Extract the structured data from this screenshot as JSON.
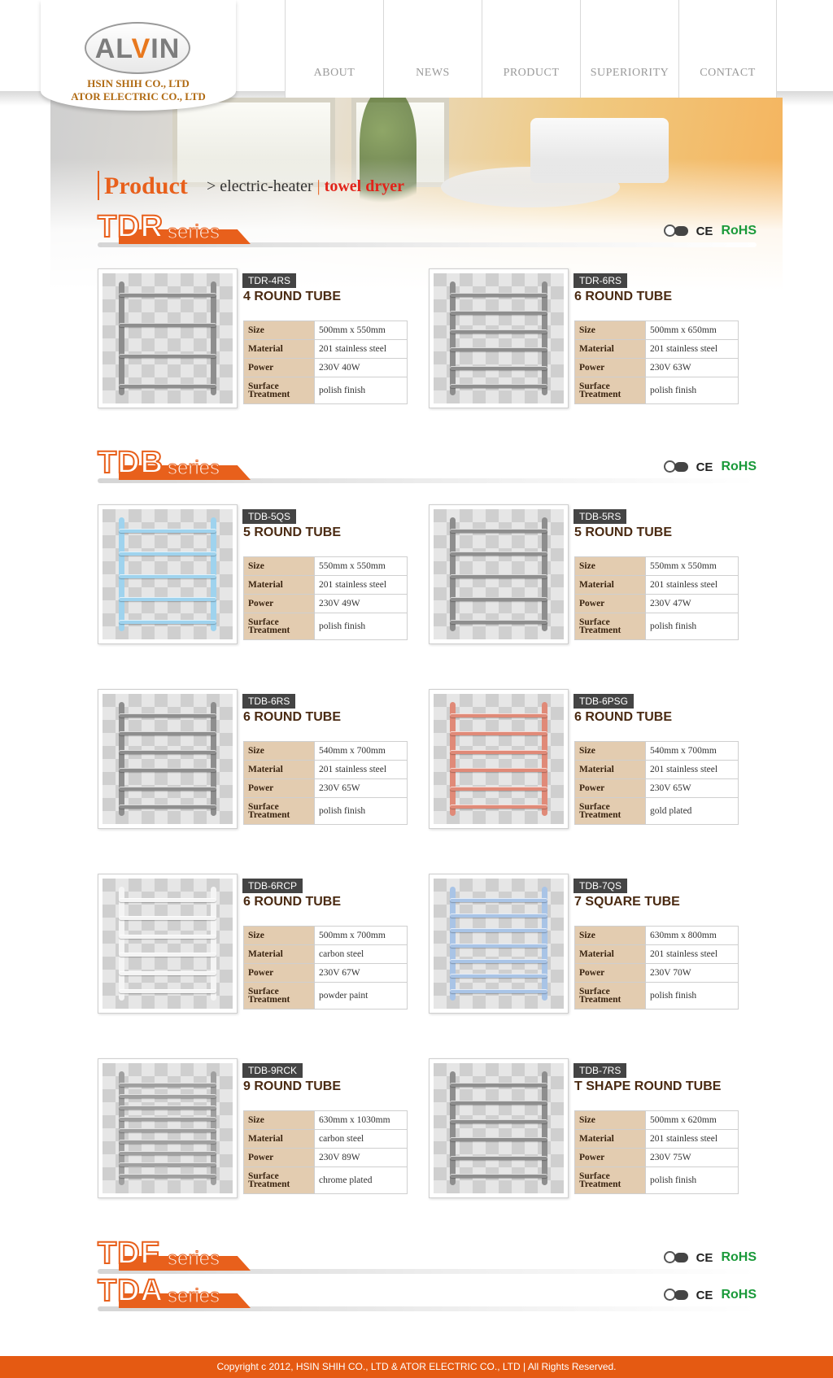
{
  "brand": {
    "logo_left": "AL",
    "logo_v": "V",
    "logo_right": "IN",
    "company_1": "HSIN SHIH CO., LTD",
    "company_2": "ATOR ELECTRIC CO., LTD"
  },
  "nav": [
    "ABOUT",
    "NEWS",
    "PRODUCT",
    "SUPERIORITY",
    "CONTACT"
  ],
  "breadcrumb": {
    "title": "Product",
    "prefix": ">",
    "category": "electric-heater",
    "separator": "|",
    "current": "towel dryer"
  },
  "series_word": "series",
  "certifications": {
    "ce": "CE",
    "rohs": "RoHS"
  },
  "spec_labels": {
    "size": "Size",
    "material": "Material",
    "power": "Power",
    "surface": "Surface Treatment"
  },
  "series": [
    {
      "code": "TDR",
      "products": [
        {
          "model": "TDR-4RS",
          "name": "4 ROUND TUBE",
          "size": "500mm x 550mm",
          "material": "201 stainless steel",
          "power": "230V 40W",
          "surface": "polish finish",
          "color": "#8e8e8e"
        },
        {
          "model": "TDR-6RS",
          "name": "6 ROUND TUBE",
          "size": "500mm x 650mm",
          "material": "201 stainless steel",
          "power": "230V 63W",
          "surface": "polish finish",
          "color": "#8e8e8e"
        }
      ]
    },
    {
      "code": "TDB",
      "products": [
        {
          "model": "TDB-5QS",
          "name": "5 ROUND TUBE",
          "size": "550mm x 550mm",
          "material": "201 stainless steel",
          "power": "230V 49W",
          "surface": "polish finish",
          "color": "#9fd3ee"
        },
        {
          "model": "TDB-5RS",
          "name": "5 ROUND TUBE",
          "size": "550mm x 550mm",
          "material": "201 stainless steel",
          "power": "230V 47W",
          "surface": "polish finish",
          "color": "#8e8e8e"
        },
        {
          "model": "TDB-6RS",
          "name": "6 ROUND TUBE",
          "size": "540mm x 700mm",
          "material": "201 stainless steel",
          "power": "230V 65W",
          "surface": "polish finish",
          "color": "#8e8e8e"
        },
        {
          "model": "TDB-6PSG",
          "name": "6 ROUND TUBE",
          "size": "540mm x 700mm",
          "material": "201 stainless steel",
          "power": "230V 65W",
          "surface": "gold plated",
          "color": "#e08a78"
        },
        {
          "model": "TDB-6RCP",
          "name": "6 ROUND TUBE",
          "size": "500mm x 700mm",
          "material": "carbon steel",
          "power": "230V 67W",
          "surface": "powder paint",
          "color": "#f4f4f4"
        },
        {
          "model": "TDB-7QS",
          "name": "7 SQUARE TUBE",
          "size": "630mm x 800mm",
          "material": "201 stainless steel",
          "power": "230V 70W",
          "surface": "polish finish",
          "color": "#a9c4e6"
        },
        {
          "model": "TDB-9RCK",
          "name": "9 ROUND TUBE",
          "size": "630mm x 1030mm",
          "material": "carbon steel",
          "power": "230V 89W",
          "surface": "chrome plated",
          "color": "#a0a0a0"
        },
        {
          "model": "TDB-7RS",
          "name": "T SHAPE ROUND TUBE",
          "size": "500mm x 620mm",
          "material": "201 stainless steel",
          "power": "230V 75W",
          "surface": "polish finish",
          "color": "#8e8e8e"
        }
      ]
    },
    {
      "code": "TDF",
      "products": []
    },
    {
      "code": "TDA",
      "products": []
    }
  ],
  "footer": "Copyright c 2012, HSIN SHIH CO., LTD & ATOR ELECTRIC CO., LTD | All Rights Reserved.",
  "colors": {
    "accent": "#e8601c",
    "breadcrumb_current": "#e2231a",
    "rohs": "#1a9a3a",
    "footer": "#e55a12",
    "spec_label_bg": "#e3ccb0"
  }
}
